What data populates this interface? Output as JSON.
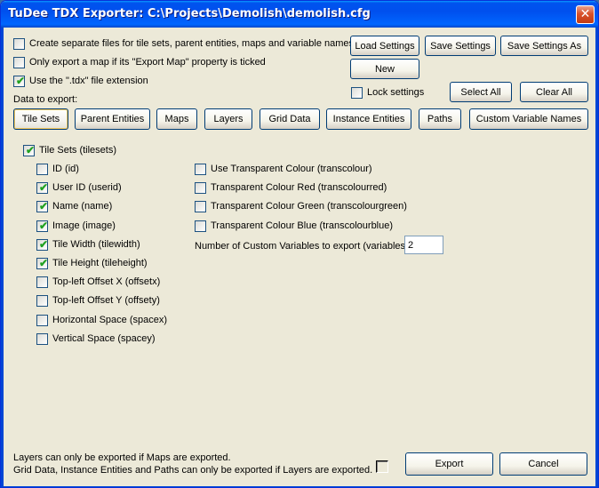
{
  "window": {
    "title": "TuDee TDX Exporter: C:\\Projects\\Demolish\\demolish.cfg",
    "close_glyph": "✕"
  },
  "options": [
    {
      "label": "Create separate files for tile sets, parent entities, maps and variable names",
      "checked": false
    },
    {
      "label": "Only export a map if its \"Export Map\" property is ticked",
      "checked": false
    },
    {
      "label": "Use the \".tdx\" file extension",
      "checked": true
    }
  ],
  "buttons": {
    "load": "Load Settings",
    "save": "Save Settings",
    "save_as": "Save Settings As",
    "new": "New",
    "select_all": "Select All",
    "clear_all": "Clear All",
    "export": "Export",
    "cancel": "Cancel"
  },
  "lock_settings": {
    "label": "Lock settings",
    "checked": false
  },
  "data_to_export_label": "Data to export:",
  "tabs": [
    "Tile Sets",
    "Parent Entities",
    "Maps",
    "Layers",
    "Grid Data",
    "Instance Entities",
    "Paths",
    "Custom Variable Names"
  ],
  "active_tab": "Tile Sets",
  "tilesets": {
    "master": {
      "label": "Tile Sets (tilesets)",
      "checked": true
    },
    "fields_left": [
      {
        "label": "ID (id)",
        "checked": false
      },
      {
        "label": "User ID (userid)",
        "checked": true
      },
      {
        "label": "Name (name)",
        "checked": true
      },
      {
        "label": "Image (image)",
        "checked": true
      },
      {
        "label": "Tile Width (tilewidth)",
        "checked": true
      },
      {
        "label": "Tile Height (tileheight)",
        "checked": true
      },
      {
        "label": "Top-left Offset X (offsetx)",
        "checked": false
      },
      {
        "label": "Top-left Offset Y (offsety)",
        "checked": false
      },
      {
        "label": "Horizontal Space (spacex)",
        "checked": false
      },
      {
        "label": "Vertical Space (spacey)",
        "checked": false
      }
    ],
    "fields_right": [
      {
        "label": "Use Transparent Colour (transcolour)",
        "checked": false
      },
      {
        "label": "Transparent Colour Red (transcolourred)",
        "checked": false
      },
      {
        "label": "Transparent Colour Green (transcolourgreen)",
        "checked": false
      },
      {
        "label": "Transparent Colour Blue (transcolourblue)",
        "checked": false
      }
    ],
    "custom_vars_label": "Number of Custom Variables to export (variables)",
    "custom_vars_value": "2"
  },
  "notes": [
    "Layers can only be exported if Maps are exported.",
    "Grid Data, Instance Entities and Paths can only be exported if Layers are exported."
  ],
  "check_glyph": "✔"
}
